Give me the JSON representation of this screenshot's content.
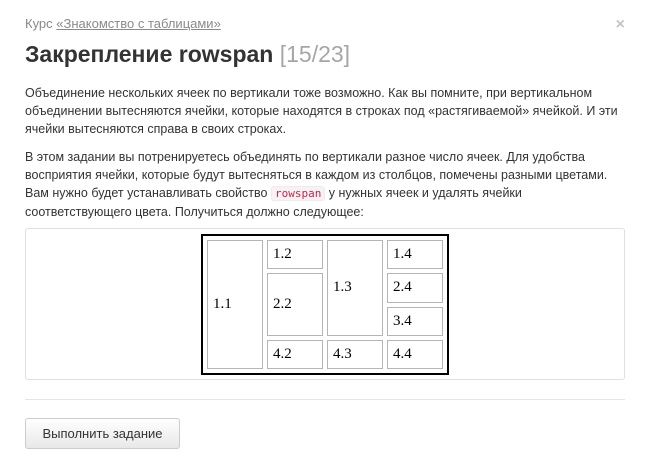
{
  "header": {
    "course_prefix": "Курс ",
    "course_link": "«Знакомство с таблицами»",
    "close_symbol": "×",
    "title": "Закрепление rowspan",
    "counter": "[15/23]"
  },
  "content": {
    "paragraph1": "Объединение нескольких ячеек по вертикали тоже возможно. Как вы помните, при вертикальном объединении вытесняются ячейки, которые находятся в строках под «растягиваемой» ячейкой. И эти ячейки вытесняются справа в своих строках.",
    "paragraph2_before": "В этом задании вы потренируетесь объединять по вертикали разное число ячеек. Для удобства восприятия ячейки, которые будут вытесняться в каждом из столбцов, помечены разными цветами. Вам нужно будет устанавливать свойство ",
    "paragraph2_code": "rowspan",
    "paragraph2_after": " у нужных ячеек и удалять ячейки соответствующего цвета. Получиться должно следующее:"
  },
  "demo_table": {
    "cells": {
      "c11": "1.1",
      "c12": "1.2",
      "c13": "1.3",
      "c14": "1.4",
      "c22": "2.2",
      "c24": "2.4",
      "c34": "3.4",
      "c42": "4.2",
      "c43": "4.3",
      "c44": "4.4"
    }
  },
  "footer": {
    "submit_label": "Выполнить задание"
  },
  "colors": {
    "text": "#333333",
    "muted": "#8a8a8a",
    "counter": "#a6a6a6",
    "code_text": "#c7254e",
    "code_bg": "#f9f2f4"
  }
}
